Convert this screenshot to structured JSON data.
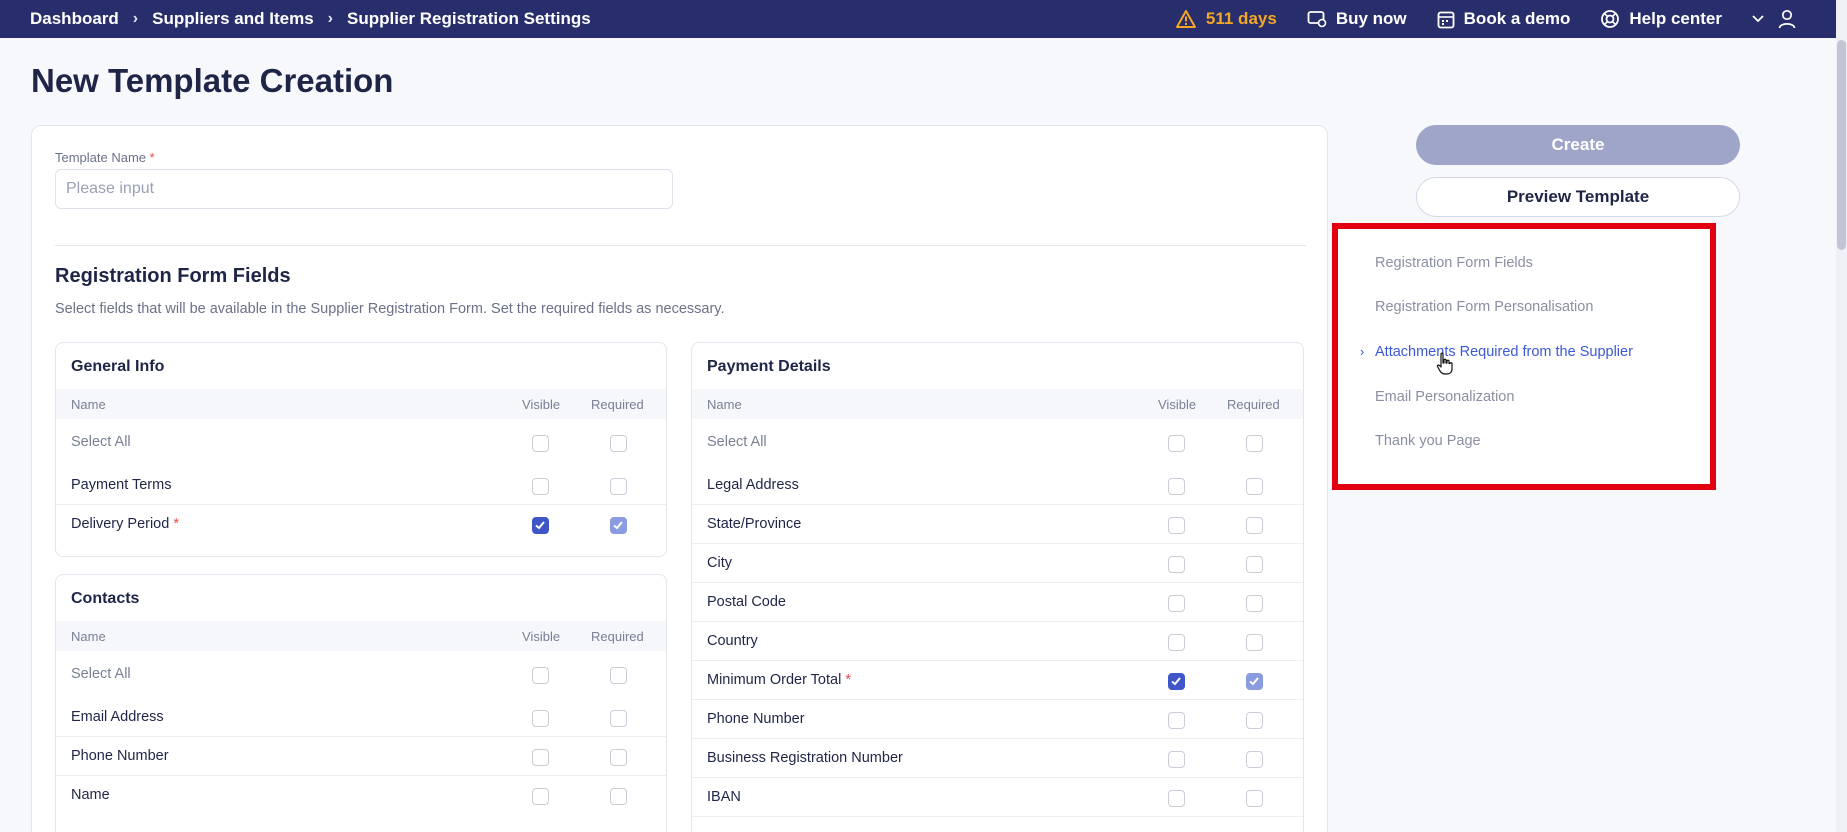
{
  "breadcrumb": [
    "Dashboard",
    "Suppliers and Items",
    "Supplier Registration Settings"
  ],
  "topbar": {
    "trial": "511 days",
    "buy": "Buy now",
    "demo": "Book a demo",
    "help": "Help center"
  },
  "page_title": "New Template Creation",
  "template_name": {
    "label": "Template Name",
    "required_mark": "*",
    "placeholder": "Please input"
  },
  "section": {
    "title": "Registration Form Fields",
    "description": "Select fields that will be available in the Supplier Registration Form. Set the required fields as necessary."
  },
  "columns": {
    "name": "Name",
    "visible": "Visible",
    "required": "Required"
  },
  "select_all": "Select All",
  "general_info": {
    "title": "General Info",
    "rows": [
      {
        "name": "Payment Terms",
        "visible": false,
        "required": false,
        "mandatory": false
      },
      {
        "name": "Delivery Period",
        "visible": true,
        "required": true,
        "mandatory": true
      }
    ]
  },
  "contacts": {
    "title": "Contacts",
    "rows": [
      {
        "name": "Email Address",
        "visible": false,
        "required": false,
        "mandatory": false
      },
      {
        "name": "Phone Number",
        "visible": false,
        "required": false,
        "mandatory": false
      },
      {
        "name": "Name",
        "visible": false,
        "required": false,
        "mandatory": false
      }
    ]
  },
  "payment_details": {
    "title": "Payment Details",
    "rows": [
      {
        "name": "Legal Address",
        "visible": false,
        "required": false,
        "mandatory": false
      },
      {
        "name": "State/Province",
        "visible": false,
        "required": false,
        "mandatory": false
      },
      {
        "name": "City",
        "visible": false,
        "required": false,
        "mandatory": false
      },
      {
        "name": "Postal Code",
        "visible": false,
        "required": false,
        "mandatory": false
      },
      {
        "name": "Country",
        "visible": false,
        "required": false,
        "mandatory": false
      },
      {
        "name": "Minimum Order Total",
        "visible": true,
        "required": true,
        "mandatory": true
      },
      {
        "name": "Phone Number",
        "visible": false,
        "required": false,
        "mandatory": false
      },
      {
        "name": "Business Registration Number",
        "visible": false,
        "required": false,
        "mandatory": false
      },
      {
        "name": "IBAN",
        "visible": false,
        "required": false,
        "mandatory": false
      }
    ]
  },
  "actions": {
    "create": "Create",
    "preview": "Preview Template"
  },
  "side_nav": [
    {
      "label": "Registration Form Fields",
      "active": false
    },
    {
      "label": "Registration Form Personalisation",
      "active": false
    },
    {
      "label": "Attachments Required from the Supplier",
      "active": true
    },
    {
      "label": "Email Personalization",
      "active": false
    },
    {
      "label": "Thank you Page",
      "active": false
    }
  ],
  "colors": {
    "topbar": "#272e6b",
    "accent": "#3f55c8",
    "highlight": "#e0000f",
    "warning": "#f5a623"
  }
}
